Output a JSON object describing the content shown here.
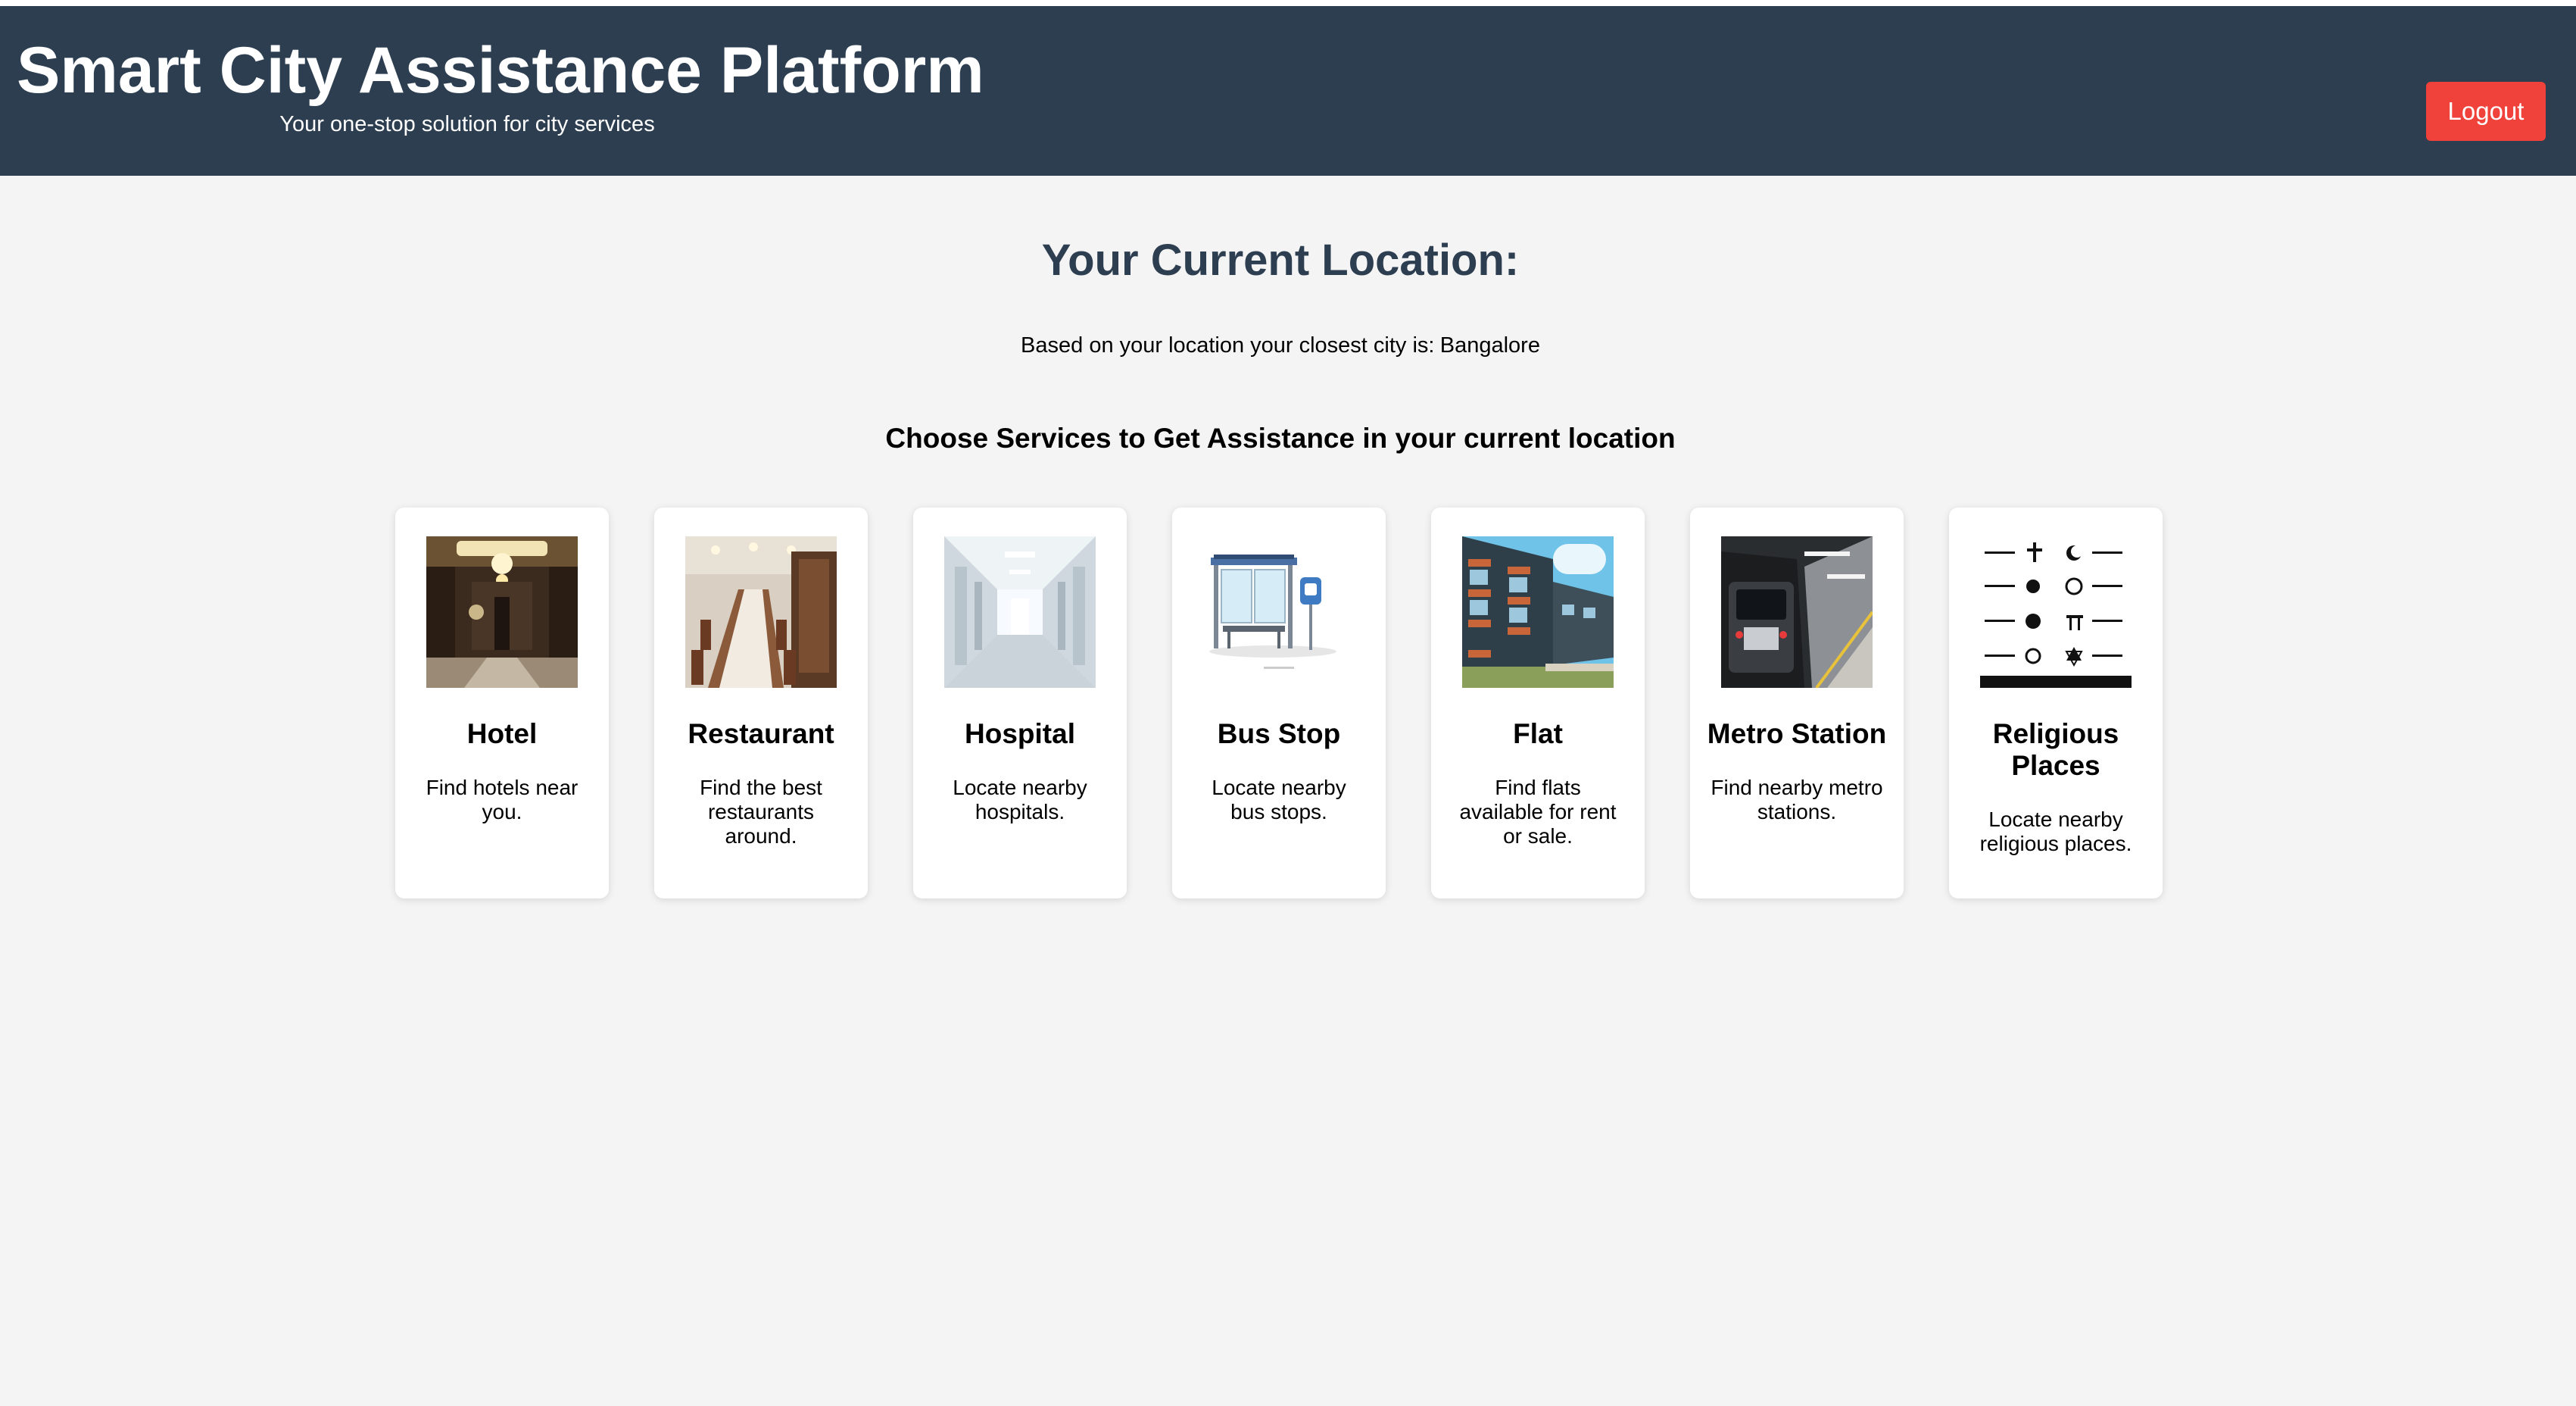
{
  "header": {
    "title": "Smart City Assistance Platform",
    "tagline": "Your one-stop solution for city services",
    "logout_label": "Logout"
  },
  "location": {
    "heading": "Your Current Location:",
    "prefix": "Based on your location your closest city is:",
    "city": "Bangalore"
  },
  "services": {
    "heading": "Choose Services to Get Assistance in your current location",
    "items": [
      {
        "title": "Hotel",
        "description": "Find hotels near you.",
        "image": "hotel-lobby-image"
      },
      {
        "title": "Restaurant",
        "description": "Find the best restaurants around.",
        "image": "restaurant-dining-image"
      },
      {
        "title": "Hospital",
        "description": "Locate nearby hospitals.",
        "image": "hospital-corridor-image"
      },
      {
        "title": "Bus Stop",
        "description": "Locate nearby bus stops.",
        "image": "bus-shelter-image"
      },
      {
        "title": "Flat",
        "description": "Find flats available for rent or sale.",
        "image": "apartment-building-image"
      },
      {
        "title": "Metro Station",
        "description": "Find nearby metro stations.",
        "image": "metro-train-image"
      },
      {
        "title": "Religious Places",
        "description": "Locate nearby religious places.",
        "image": "religious-symbols-image"
      }
    ]
  },
  "colors": {
    "header_bg": "#2c3e50",
    "logout_bg": "#f0423a",
    "page_bg": "#f4f4f4",
    "heading": "#2c3e50"
  }
}
